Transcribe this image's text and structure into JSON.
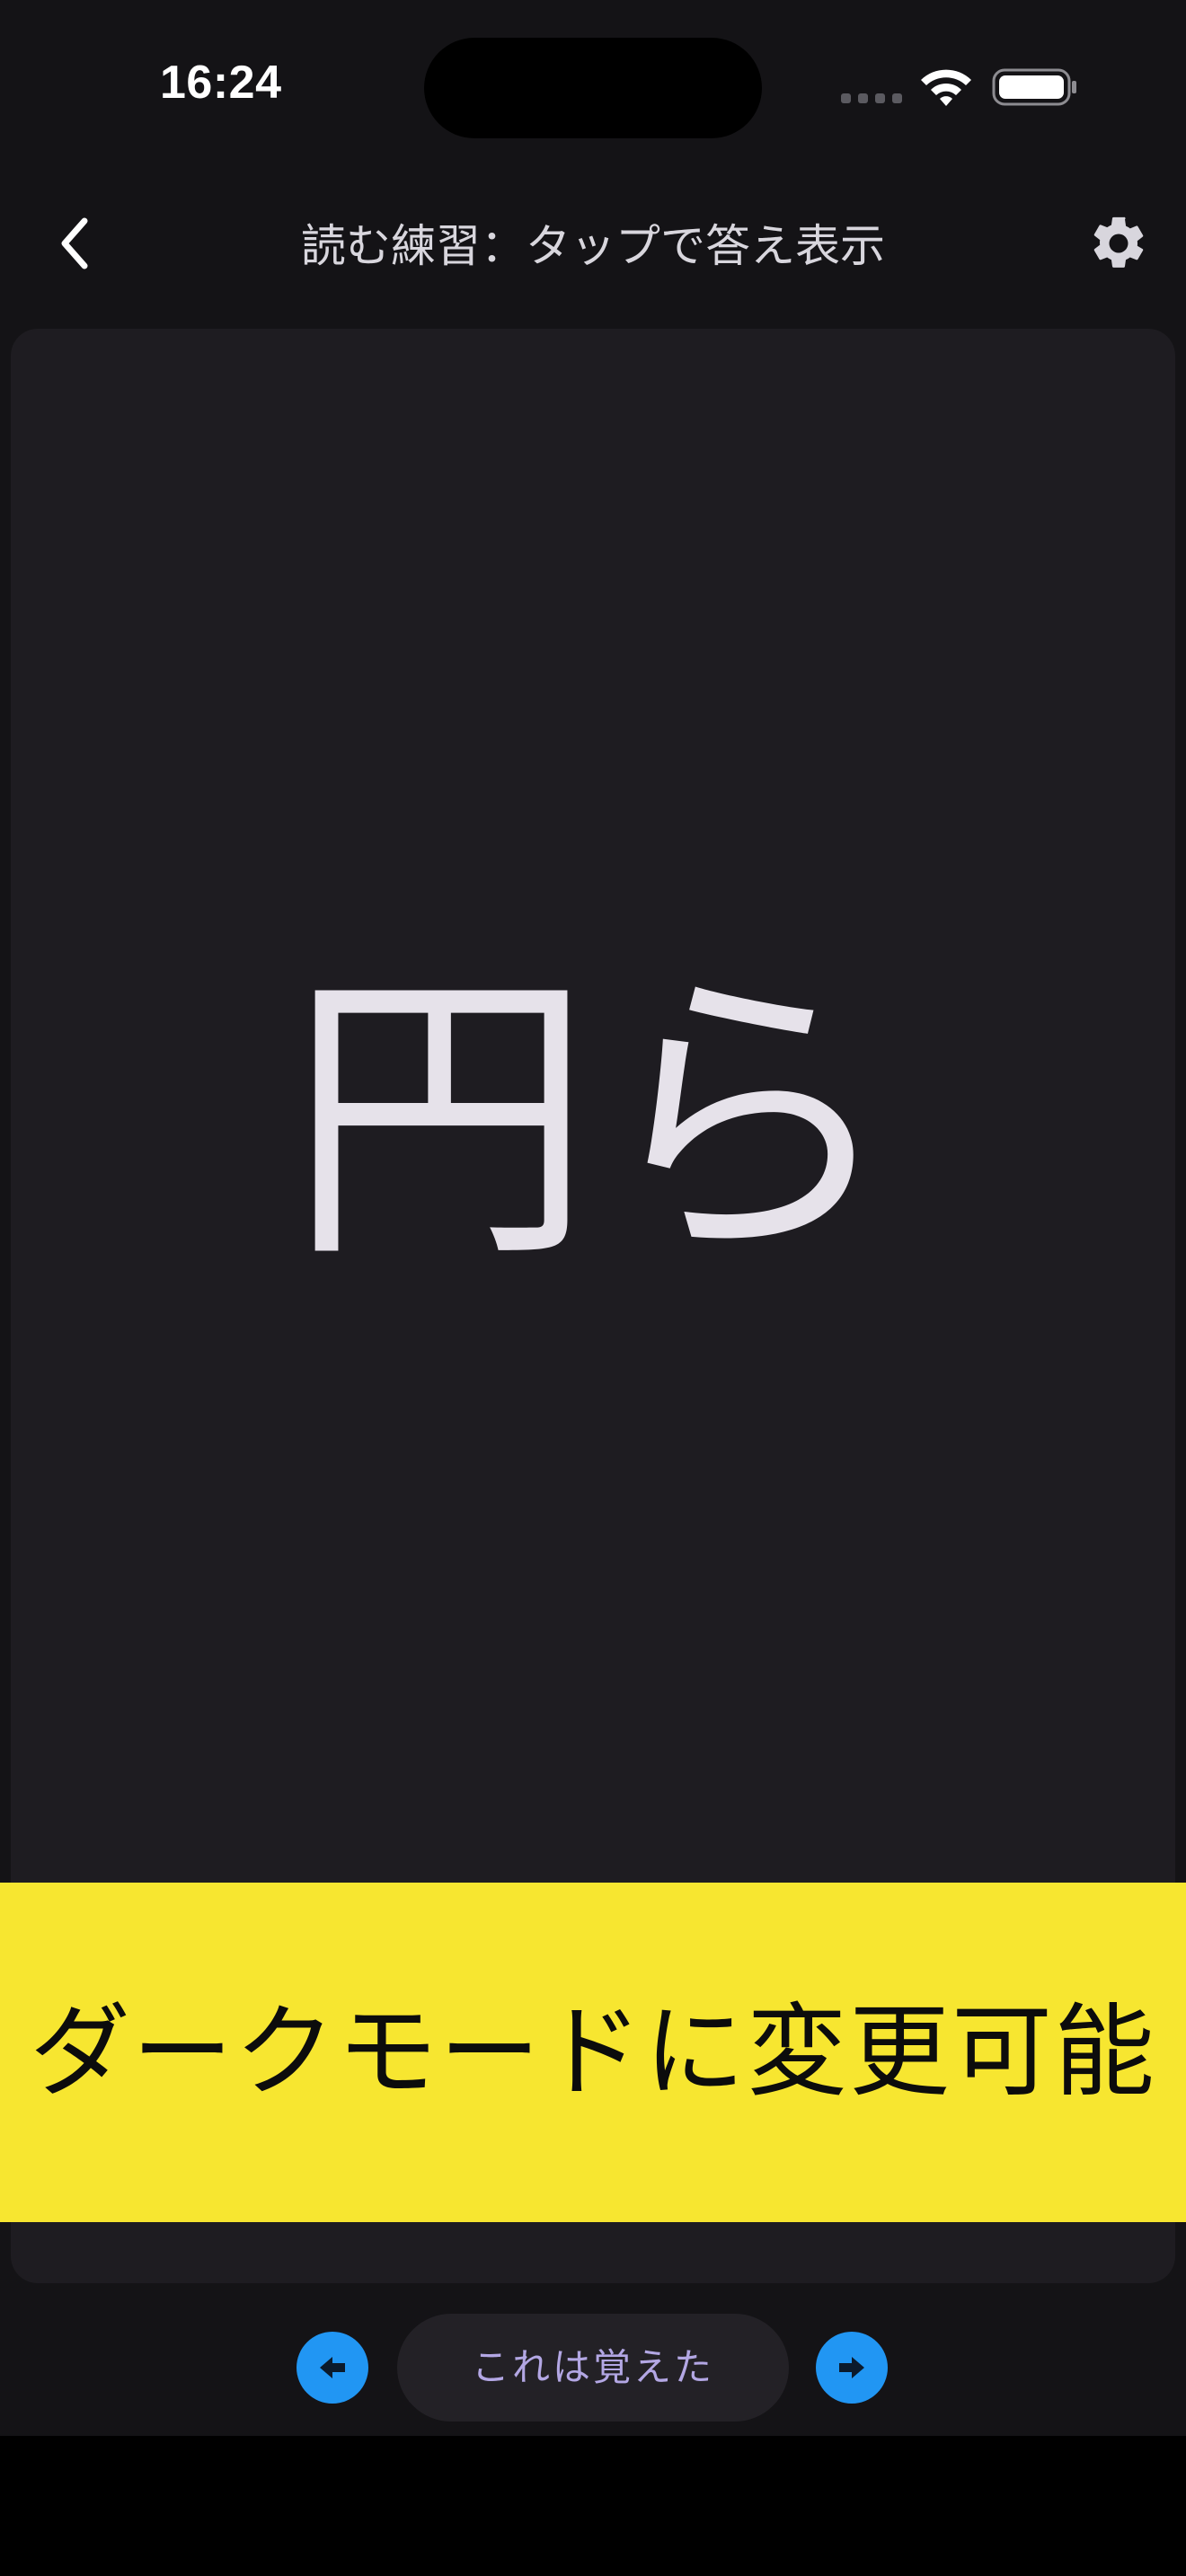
{
  "status_bar": {
    "time": "16:24",
    "wifi_icon": "wifi-icon",
    "battery_icon": "battery-icon"
  },
  "nav": {
    "back_icon": "chevron-left-icon",
    "title": "読む練習：タップで答え表示",
    "settings_icon": "gear-icon"
  },
  "card": {
    "word": "円ら"
  },
  "banner": {
    "text": "ダークモードに変更可能",
    "color": "#f7e630"
  },
  "controls": {
    "prev_icon": "arrow-left-icon",
    "memorized_label": "これは覚えた",
    "next_icon": "arrow-right-icon",
    "accent_color": "#2196f3"
  }
}
